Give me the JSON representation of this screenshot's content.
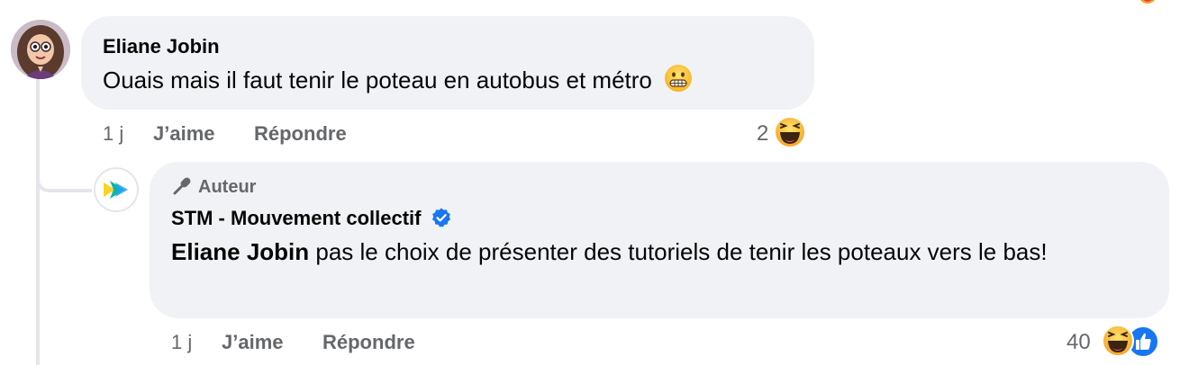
{
  "comments": [
    {
      "author": "Eliane Jobin",
      "text": "Ouais mais il faut tenir le poteau en autobus et métro",
      "emoji": "grimacing-face",
      "time": "1 j",
      "like_label": "J’aime",
      "reply_label": "Répondre",
      "reaction_count": "2",
      "reactions": [
        "haha"
      ]
    },
    {
      "badge": "Auteur",
      "author": "STM - Mouvement collectif",
      "verified": true,
      "mention": "Eliane Jobin",
      "text": " pas le choix de présenter des tutoriels de tenir les poteaux vers le bas!",
      "time": "1 j",
      "like_label": "J’aime",
      "reply_label": "Répondre",
      "reaction_count": "40",
      "reactions": [
        "haha",
        "like"
      ]
    }
  ],
  "colors": {
    "bubble": "#f0f2f5",
    "secondary_text": "#65676b",
    "verified_blue": "#1877f2",
    "like_blue": "#1877f2",
    "haha_yellow": "#f7b125"
  }
}
